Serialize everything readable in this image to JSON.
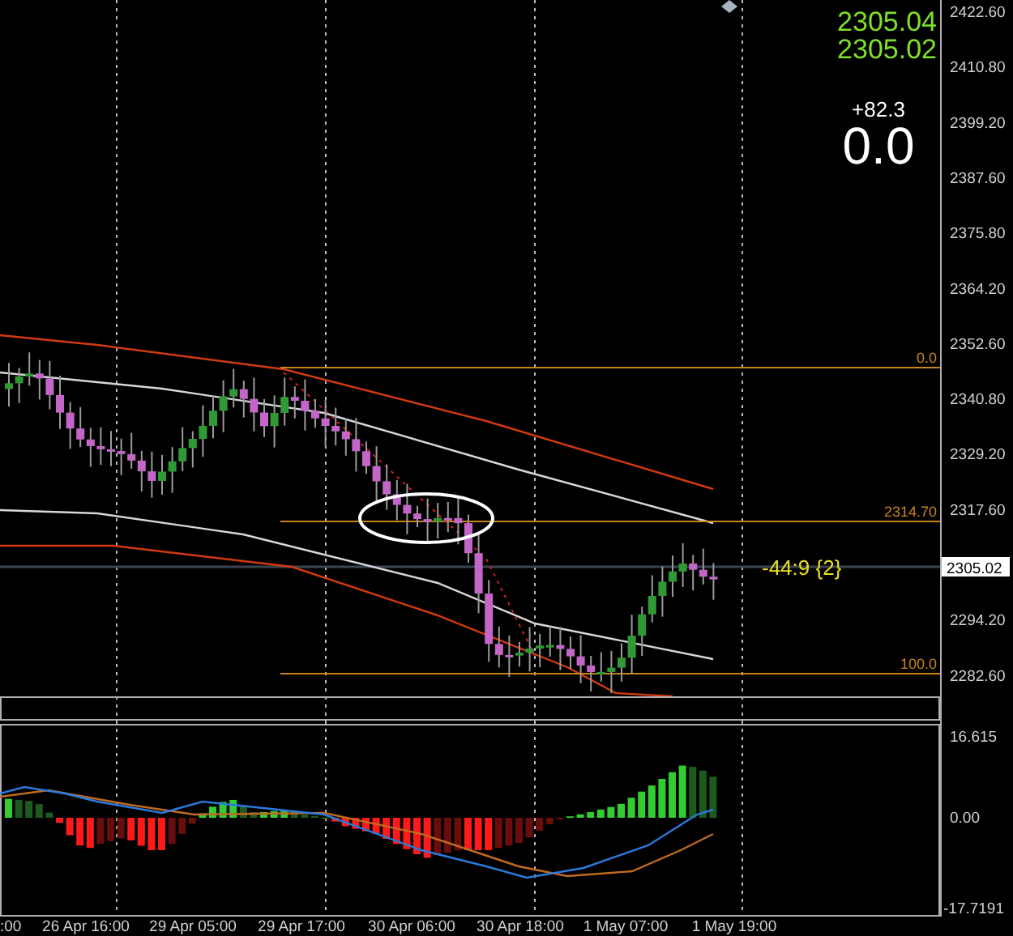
{
  "quote": {
    "ask": "2305.04",
    "bid": "2305.02"
  },
  "spread": {
    "change": "+82.3",
    "value": "0.0"
  },
  "price_axis": {
    "labels": [
      "2422.60",
      "2410.80",
      "2399.20",
      "2387.60",
      "2375.80",
      "2364.20",
      "2352.60",
      "2340.80",
      "2329.20",
      "2317.60",
      "2294.20",
      "2282.60"
    ],
    "current_price": "2305.02"
  },
  "fibonacci": {
    "levels": [
      {
        "label": "0.0"
      },
      {
        "label": "2314.70"
      },
      {
        "label": "100.0"
      }
    ]
  },
  "annotation": "-44:9 {2}",
  "indicator_axis": {
    "labels": [
      "16.615",
      "0.00",
      "-17.7191"
    ]
  },
  "time_axis": {
    "labels": [
      ":00",
      "26 Apr 16:00",
      "29 Apr 05:00",
      "29 Apr 17:00",
      "30 Apr 06:00",
      "30 Apr 18:00",
      "1 May 07:00",
      "1 May 19:00"
    ]
  }
}
